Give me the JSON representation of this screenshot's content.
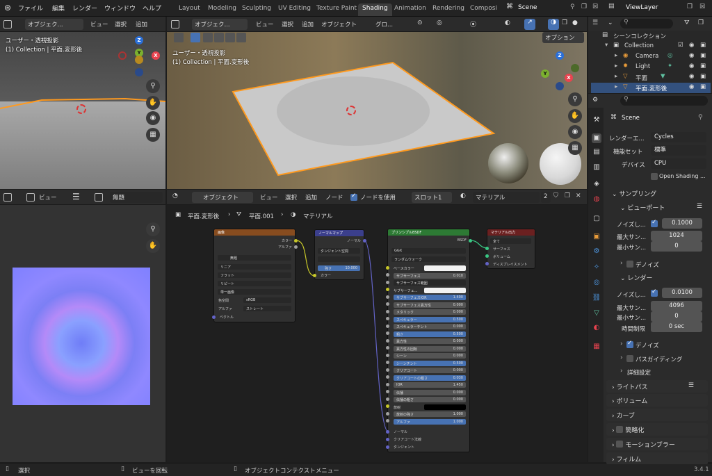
{
  "topbar": {
    "menus": [
      "ファイル",
      "編集",
      "レンダー",
      "ウィンドウ",
      "ヘルプ"
    ],
    "workspaces": [
      "Layout",
      "Modeling",
      "Sculpting",
      "UV Editing",
      "Texture Paint",
      "Shading",
      "Animation",
      "Rendering",
      "Composi"
    ],
    "active_workspace": "Shading",
    "scene_name": "Scene",
    "viewlayer_name": "ViewLayer"
  },
  "viewport_left": {
    "mode": "オブジェク...",
    "menus": [
      "ビュー",
      "選択",
      "追加"
    ],
    "overlay_line1": "ユーザー・透視投影",
    "overlay_line2": "(1) Collection | 平面.変形後"
  },
  "viewport_main": {
    "mode": "オブジェク...",
    "menus": [
      "ビュー",
      "選択",
      "追加",
      "オブジェクト"
    ],
    "transform": "グロ...",
    "options": "オプション",
    "overlay_line1": "ユーザー・透視投影",
    "overlay_line2": "(1) Collection | 平面.変形後"
  },
  "image_editor": {
    "menu": "ビュー",
    "image_name": "無題"
  },
  "node_editor": {
    "mode": "オブジェクト",
    "menus": [
      "ビュー",
      "選択",
      "追加",
      "ノード"
    ],
    "use_nodes_label": "ノードを使用",
    "slot": "スロット1",
    "material": "マテリアル",
    "user_count": "2",
    "breadcrumb": [
      "平面.変形後",
      "平面.001",
      "マテリアル"
    ]
  },
  "nodes": {
    "image": {
      "title": "画像",
      "out_color": "カラー",
      "out_alpha": "アルファ",
      "image_name": "無題",
      "interp": "リニア",
      "projection": "フラット",
      "extension": "リピート",
      "source": "単一画像",
      "colorspace_label": "色空間",
      "colorspace": "sRGB",
      "alpha_label": "アルファ",
      "alpha_mode": "ストレート",
      "in_vector": "ベクトル"
    },
    "normalmap": {
      "title": "ノーマルマップ",
      "out_normal": "ノーマル",
      "space": "タンジェント空間",
      "strength_label": "強さ",
      "strength": "10.000",
      "in_color": "カラー"
    },
    "principled": {
      "title": "プリンシプルBSDF",
      "out_bsdf": "BSDF",
      "distribution": "GGX",
      "subsurface_method": "ランダムウォーク",
      "rows": [
        {
          "label": "ベースカラー",
          "value": "",
          "kind": "color"
        },
        {
          "label": "サブサーフェス",
          "value": "0.010",
          "kind": "num"
        },
        {
          "label": "サブサーフェス範囲",
          "value": "",
          "kind": "drop"
        },
        {
          "label": "サブサーフェ...",
          "value": "",
          "kind": "color"
        },
        {
          "label": "サブサーフェスIOR",
          "value": "1.400",
          "kind": "blue"
        },
        {
          "label": "サブサーフェス異方性",
          "value": "0.000",
          "kind": "num"
        },
        {
          "label": "メタリック",
          "value": "0.000",
          "kind": "num"
        },
        {
          "label": "スペキュラー",
          "value": "0.500",
          "kind": "blue"
        },
        {
          "label": "スペキュラーチント",
          "value": "0.000",
          "kind": "num"
        },
        {
          "label": "粗さ",
          "value": "0.500",
          "kind": "blue"
        },
        {
          "label": "異方性",
          "value": "0.000",
          "kind": "num"
        },
        {
          "label": "異方性の回転",
          "value": "0.000",
          "kind": "num"
        },
        {
          "label": "シーン",
          "value": "0.000",
          "kind": "num"
        },
        {
          "label": "シーンチント",
          "value": "0.500",
          "kind": "blue"
        },
        {
          "label": "クリアコート",
          "value": "0.000",
          "kind": "num"
        },
        {
          "label": "クリアコートの粗さ",
          "value": "0.030",
          "kind": "blue"
        },
        {
          "label": "IOR",
          "value": "1.450",
          "kind": "num"
        },
        {
          "label": "伝播",
          "value": "0.000",
          "kind": "num"
        },
        {
          "label": "伝播の粗さ",
          "value": "0.000",
          "kind": "num"
        },
        {
          "label": "放射",
          "value": "",
          "kind": "black"
        },
        {
          "label": "放射の強さ",
          "value": "1.000",
          "kind": "num"
        },
        {
          "label": "アルファ",
          "value": "1.000",
          "kind": "blue"
        }
      ],
      "in_normal": "ノーマル",
      "in_clearcoat_normal": "クリアコート法線",
      "in_tangent": "タンジェント"
    },
    "output": {
      "title": "マテリアル出力",
      "target": "全て",
      "in_surface": "サーフェス",
      "in_volume": "ボリューム",
      "in_displacement": "ディスプレイスメント"
    }
  },
  "outliner": {
    "title": "シーンコレクション",
    "items": [
      {
        "label": "Collection",
        "level": 1,
        "icon": "collection-icon"
      },
      {
        "label": "Camera",
        "level": 2,
        "icon": "camera-icon"
      },
      {
        "label": "Light",
        "level": 2,
        "icon": "light-icon"
      },
      {
        "label": "平面",
        "level": 2,
        "icon": "mesh-icon"
      },
      {
        "label": "平面.変形後",
        "level": 2,
        "icon": "mesh-icon",
        "selected": true
      }
    ]
  },
  "properties": {
    "scene": "Scene",
    "render_engine_label": "レンダーエ...",
    "render_engine": "Cycles",
    "feature_set_label": "機能セット",
    "feature_set": "標準",
    "device_label": "デバイス",
    "device": "CPU",
    "open_shading": "Open Shading ...",
    "sampling": "サンプリング",
    "viewport": "ビューポート",
    "noise_threshold_label": "ノイズし...",
    "viewport_noise": "0.1000",
    "max_samples_label": "最大サン...",
    "viewport_max": "1024",
    "min_samples_label": "最小サン...",
    "viewport_min": "0",
    "denoise": "デノイズ",
    "render": "レンダー",
    "render_noise": "0.0100",
    "render_max": "4096",
    "render_min": "0",
    "time_limit_label": "時間制限",
    "time_limit": "0 sec",
    "render_denoise": "デノイズ",
    "path_guiding": "パスガイディング",
    "advanced": "詳細設定",
    "light_paths": "ライトパス",
    "volumes": "ボリューム",
    "curves": "カーブ",
    "simplify": "簡略化",
    "motion_blur": "モーションブラー",
    "film": "フィルム"
  },
  "statusbar": {
    "select": "選択",
    "rotate": "ビューを回転",
    "context": "オブジェクトコンテクストメニュー",
    "version": "3.4.1"
  },
  "colors": {
    "accent": "#4772b3",
    "node_image_header": "#874c1f",
    "node_vector_header": "#3b3f8c",
    "node_shader_header": "#2d7a34",
    "node_output_header": "#6b2020",
    "selection_orange": "#ff9a1f"
  }
}
